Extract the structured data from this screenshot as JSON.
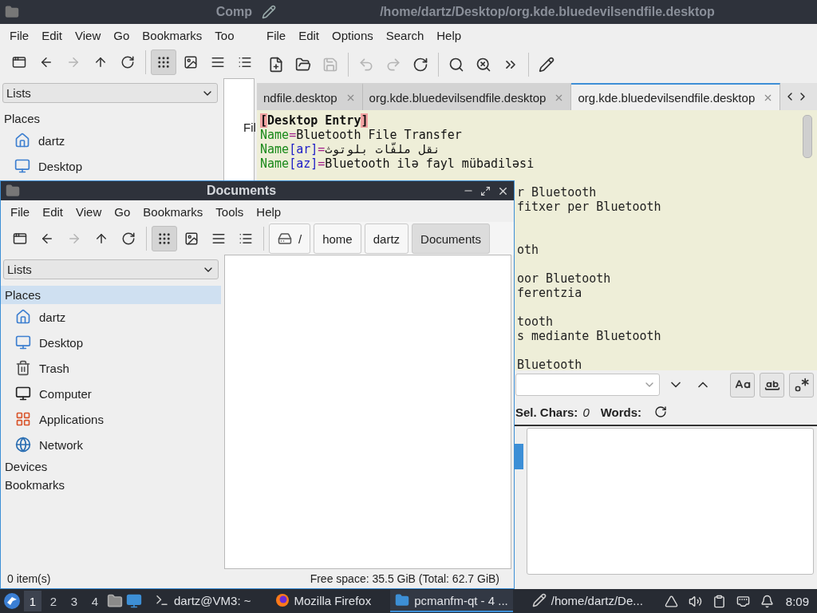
{
  "back_window": {
    "title": "Comp",
    "menu": [
      "File",
      "Edit",
      "View",
      "Go",
      "Bookmarks",
      "Too"
    ],
    "toolbar": [
      [
        {
          "kind": "new-tab",
          "disabled": false,
          "selected": false
        },
        {
          "kind": "back",
          "disabled": false,
          "selected": false
        },
        {
          "kind": "forward",
          "disabled": true,
          "selected": false
        },
        {
          "kind": "up",
          "disabled": false,
          "selected": false
        },
        {
          "kind": "reload",
          "disabled": false,
          "selected": false
        }
      ],
      [
        {
          "kind": "icon-view",
          "disabled": false,
          "selected": true
        },
        {
          "kind": "thumb-view",
          "disabled": false,
          "selected": false
        },
        {
          "kind": "compact-view",
          "disabled": false,
          "selected": false
        },
        {
          "kind": "detail-view",
          "disabled": false,
          "selected": false
        }
      ]
    ],
    "dropdown": "Lists",
    "sidebar_items": [
      {
        "kind": "header",
        "label": "Places",
        "selected": false
      },
      {
        "kind": "home",
        "label": "dartz",
        "selected": false
      },
      {
        "kind": "desktop",
        "label": "Desktop",
        "selected": false
      }
    ],
    "content_text": "Fil"
  },
  "editor": {
    "title": "/home/dartz/Desktop/org.kde.bluedevilsendfile.desktop",
    "menu": [
      "File",
      "Edit",
      "Options",
      "Search",
      "Help"
    ],
    "toolbar": [
      [
        {
          "kind": "new",
          "disabled": false
        },
        {
          "kind": "open",
          "disabled": false
        },
        {
          "kind": "save",
          "disabled": true
        }
      ],
      [
        {
          "kind": "undo",
          "disabled": true
        },
        {
          "kind": "redo",
          "disabled": true
        },
        {
          "kind": "reload",
          "disabled": false
        }
      ],
      [
        {
          "kind": "find",
          "disabled": false
        },
        {
          "kind": "replace",
          "disabled": false
        },
        {
          "kind": "more",
          "disabled": false
        }
      ],
      [
        {
          "kind": "edit",
          "disabled": false
        }
      ]
    ],
    "tabs": [
      {
        "label": "ndfile.desktop",
        "selected": false
      },
      {
        "label": "org.kde.bluedevilsendfile.desktop",
        "selected": false
      },
      {
        "label": "org.kde.bluedevilsendfile.desktop",
        "selected": true
      }
    ],
    "lines": [
      {
        "kind": "full",
        "segments": [
          {
            "text": "[",
            "kind": "bracket"
          },
          {
            "text": "Desktop Entry",
            "kind": "section"
          },
          {
            "text": "]",
            "kind": "bracket"
          }
        ]
      },
      {
        "kind": "full",
        "segments": [
          {
            "text": "Name",
            "kind": "key"
          },
          {
            "text": "=",
            "kind": "eq"
          },
          {
            "text": "Bluetooth File Transfer",
            "kind": "value"
          }
        ]
      },
      {
        "kind": "full",
        "segments": [
          {
            "text": "Name",
            "kind": "key"
          },
          {
            "text": "[ar]",
            "kind": "locale"
          },
          {
            "text": "=",
            "kind": "eq"
          },
          {
            "text": "نقل ملفّات بلوتوث",
            "kind": "value"
          }
        ]
      },
      {
        "kind": "full",
        "segments": [
          {
            "text": "Name",
            "kind": "key"
          },
          {
            "text": "[az]",
            "kind": "locale"
          },
          {
            "text": "=",
            "kind": "eq"
          },
          {
            "text": "Bluetooth ilə fayl mübadiləsi",
            "kind": "value"
          }
        ]
      },
      {
        "kind": "covered"
      },
      {
        "kind": "fragment",
        "text": "r Bluetooth"
      },
      {
        "kind": "fragment",
        "text": "fitxer per Bluetooth"
      },
      {
        "kind": "covered"
      },
      {
        "kind": "covered"
      },
      {
        "kind": "fragment",
        "text": "oth"
      },
      {
        "kind": "covered"
      },
      {
        "kind": "fragment",
        "text": "oor Bluetooth"
      },
      {
        "kind": "fragment",
        "text": "ferentzia"
      },
      {
        "kind": "covered"
      },
      {
        "kind": "fragment",
        "text": "tooth"
      },
      {
        "kind": "fragment",
        "text": "s mediante Bluetooth"
      },
      {
        "kind": "covered"
      },
      {
        "kind": "fragment",
        "text": "Bluetooth"
      }
    ],
    "find_buttons": [
      {
        "kind": "case",
        "selected": false
      },
      {
        "kind": "whole",
        "selected": false
      },
      {
        "kind": "regex",
        "selected": false
      }
    ],
    "status": {
      "sel_label": "Sel. Chars:",
      "sel_value": "0",
      "words_label": "Words:"
    }
  },
  "documents": {
    "title": "Documents",
    "menu": [
      "File",
      "Edit",
      "View",
      "Go",
      "Bookmarks",
      "Tools",
      "Help"
    ],
    "toolbar": [
      [
        {
          "kind": "new-tab",
          "disabled": false,
          "selected": false
        },
        {
          "kind": "back",
          "disabled": false,
          "selected": false
        },
        {
          "kind": "forward",
          "disabled": true,
          "selected": false
        },
        {
          "kind": "up",
          "disabled": false,
          "selected": false
        },
        {
          "kind": "reload",
          "disabled": false,
          "selected": false
        }
      ],
      [
        {
          "kind": "icon-view",
          "disabled": false,
          "selected": true
        },
        {
          "kind": "thumb-view",
          "disabled": false,
          "selected": false
        },
        {
          "kind": "compact-view",
          "disabled": false,
          "selected": false
        },
        {
          "kind": "detail-view",
          "disabled": false,
          "selected": false
        }
      ]
    ],
    "path": [
      {
        "label": "/",
        "kind": "root",
        "selected": false
      },
      {
        "label": "home",
        "kind": "dir",
        "selected": false
      },
      {
        "label": "dartz",
        "kind": "dir",
        "selected": false
      },
      {
        "label": "Documents",
        "kind": "dir",
        "selected": true
      }
    ],
    "dropdown": "Lists",
    "sidebar_items": [
      {
        "kind": "header",
        "label": "Places",
        "selected": true
      },
      {
        "kind": "home",
        "label": "dartz",
        "selected": false
      },
      {
        "kind": "desktop",
        "label": "Desktop",
        "selected": false
      },
      {
        "kind": "trash",
        "label": "Trash",
        "selected": false
      },
      {
        "kind": "computer",
        "label": "Computer",
        "selected": false
      },
      {
        "kind": "apps",
        "label": "Applications",
        "selected": false
      },
      {
        "kind": "network",
        "label": "Network",
        "selected": false
      },
      {
        "kind": "header",
        "label": "Devices",
        "selected": false
      },
      {
        "kind": "header",
        "label": "Bookmarks",
        "selected": false
      }
    ],
    "status_left": "0 item(s)",
    "status_right": "Free space: 35.5 GiB (Total: 62.7 GiB)"
  },
  "taskbar": {
    "workspaces": [
      {
        "label": "1",
        "selected": true
      },
      {
        "label": "2",
        "selected": false
      },
      {
        "label": "3",
        "selected": false
      },
      {
        "label": "4",
        "selected": false
      }
    ],
    "tasks": [
      {
        "kind": "terminal",
        "label": "dartz@VM3: ~",
        "selected": false
      },
      {
        "kind": "browser",
        "label": "Mozilla Firefox",
        "selected": false
      },
      {
        "kind": "files",
        "label": "pcmanfm-qt - 4 ...",
        "selected": true
      },
      {
        "kind": "editor",
        "label": "/home/dartz/De...",
        "selected": false
      }
    ],
    "clock": "8:09"
  }
}
